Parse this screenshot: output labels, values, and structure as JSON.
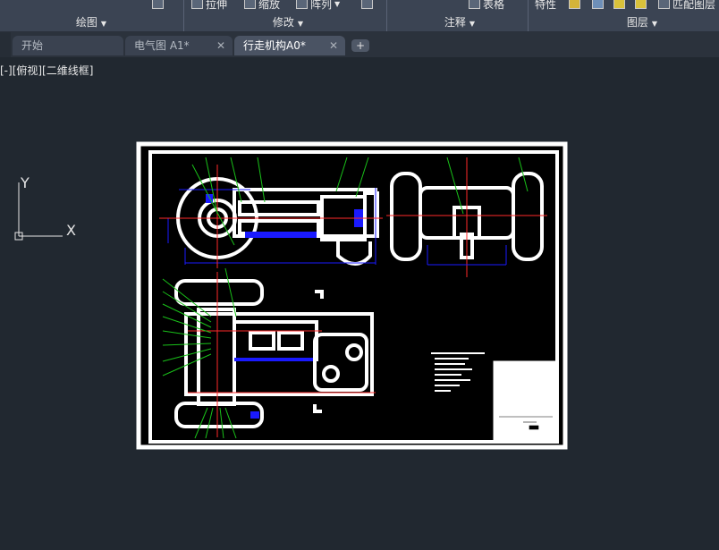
{
  "ribbon": {
    "tools": [
      {
        "label": "拉伸",
        "icon": "stretch-icon"
      },
      {
        "label": "缩放",
        "icon": "scale-icon"
      },
      {
        "label": "阵列",
        "icon": "array-icon"
      },
      {
        "label": "表格",
        "icon": "table-icon"
      },
      {
        "label": "特性",
        "icon": "properties-icon"
      },
      {
        "label": "匹配图层",
        "icon": "match-layer-icon"
      }
    ],
    "panels": [
      {
        "label": "绘图"
      },
      {
        "label": "修改"
      },
      {
        "label": "注释"
      },
      {
        "label": "图层"
      }
    ]
  },
  "tabs": [
    {
      "label": "开始",
      "closable": false
    },
    {
      "label": "电气图 A1*",
      "closable": true
    },
    {
      "label": "行走机构A0*",
      "closable": true,
      "active": true
    }
  ],
  "tab_add_label": "+",
  "viewport": {
    "label": "[-][俯视][二维线框]"
  },
  "ucs": {
    "y_label": "Y",
    "x_label": "X"
  },
  "colors": {
    "canvas": "#212830",
    "ribbon": "#3b4453",
    "drawing_lines": "#ffffff",
    "centerlines": "#ff2a2a",
    "dimensions": "#1a1aff",
    "leaders": "#19c119"
  }
}
